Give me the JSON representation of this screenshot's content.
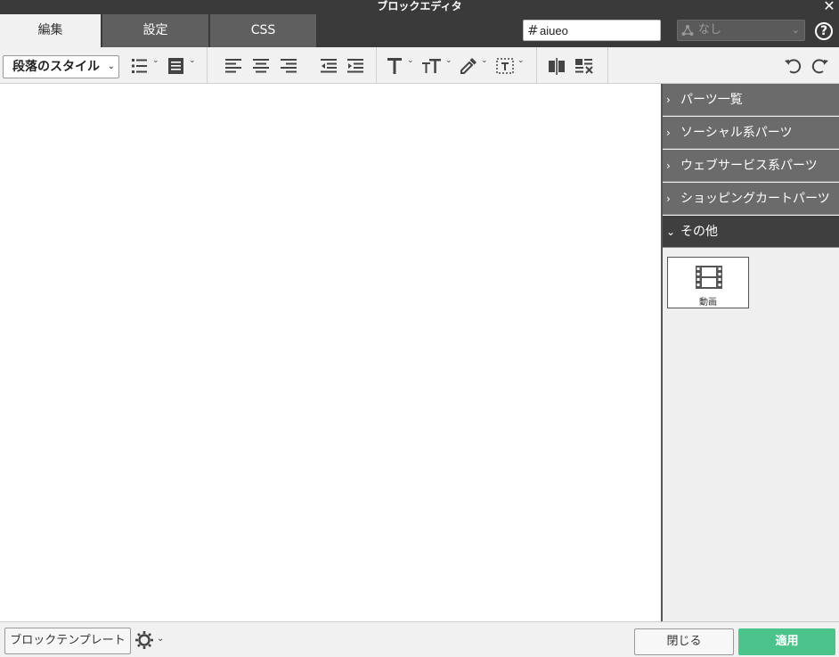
{
  "window": {
    "title": "ブロックエディタ"
  },
  "tabs": [
    {
      "label": "編集",
      "active": true
    },
    {
      "label": "設定"
    },
    {
      "label": "CSS"
    }
  ],
  "id_field": {
    "prefix": "#",
    "value": "aiueo"
  },
  "class_select": {
    "selected": "なし"
  },
  "toolbar": {
    "paragraph_style": "段落のスタイル",
    "icons": [
      "bulleted-list-icon",
      "block-format-icon",
      "align-left-icon",
      "align-center-icon",
      "align-right-icon",
      "outdent-icon",
      "indent-icon",
      "text-icon",
      "text-size-icon",
      "color-picker-icon",
      "border-box-icon",
      "column-icon",
      "clear-format-icon",
      "undo-icon",
      "redo-icon"
    ]
  },
  "panel": {
    "sections": [
      {
        "label": "パーツ一覧",
        "open": false
      },
      {
        "label": "ソーシャル系パーツ",
        "open": false
      },
      {
        "label": "ウェブサービス系パーツ",
        "open": false
      },
      {
        "label": "ショッピングカートパーツ",
        "open": false
      },
      {
        "label": "その他",
        "open": true
      }
    ],
    "parts": [
      {
        "label": "動画",
        "icon": "film-icon"
      }
    ]
  },
  "footer": {
    "template_button": "ブロックテンプレート",
    "close_button": "閉じる",
    "apply_button": "適用"
  },
  "colors": {
    "titlebar": "#3a3a3a",
    "tab_inactive": "#5f5f5f",
    "panel_header": "#6b6b6b",
    "panel_header_open": "#3f3f3f",
    "apply": "#4cc38a"
  }
}
